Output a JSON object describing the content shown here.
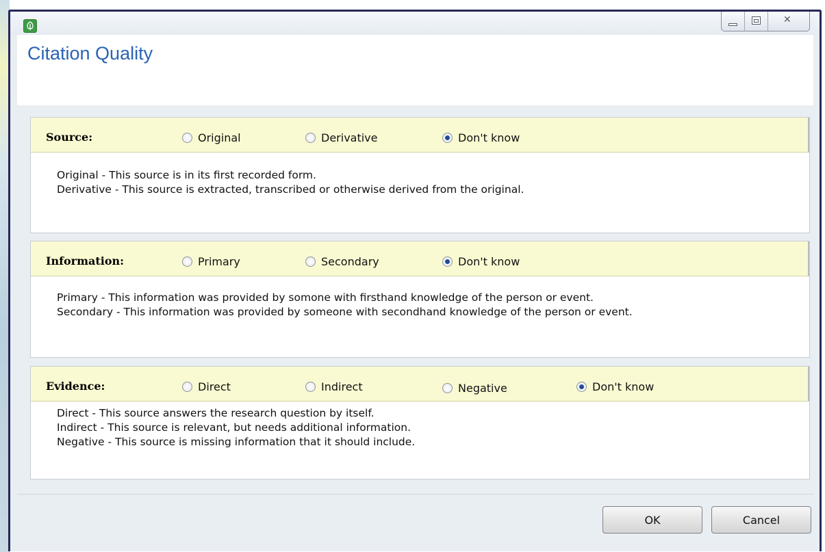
{
  "window": {
    "controls": {
      "minimize": "minimize",
      "maximize": "maximize",
      "close": "close"
    }
  },
  "dialog": {
    "title": "Citation Quality"
  },
  "sections": {
    "source": {
      "label": "Source:",
      "options": [
        "Original",
        "Derivative",
        "Don't know"
      ],
      "selected": "Don't know",
      "descriptions": [
        "Original - This source is in its first recorded form.",
        "Derivative - This source is extracted, transcribed or otherwise derived from the original."
      ]
    },
    "information": {
      "label": "Information:",
      "options": [
        "Primary",
        "Secondary",
        "Don't know"
      ],
      "selected": "Don't know",
      "descriptions": [
        "Primary - This information was provided by somone with firsthand knowledge of the person or event.",
        "Secondary - This information was provided by someone with secondhand knowledge of the person or event."
      ]
    },
    "evidence": {
      "label": "Evidence:",
      "options": [
        "Direct",
        "Indirect",
        "Negative",
        "Don't know"
      ],
      "selected": "Don't know",
      "descriptions": [
        "Direct - This source answers the research question by itself.",
        "Indirect - This source is relevant, but needs additional information.",
        "Negative - This source is missing information that it should include."
      ]
    }
  },
  "buttons": {
    "ok": "OK",
    "cancel": "Cancel"
  },
  "colors": {
    "title": "#2a63b4",
    "panel_header": "#fafad2",
    "frame": "#27285a",
    "app_icon": "#3e9a45"
  },
  "icons": {
    "app": "tree-leaf-icon",
    "minimize": "minimize-icon",
    "maximize": "maximize-icon",
    "close": "close-icon"
  }
}
